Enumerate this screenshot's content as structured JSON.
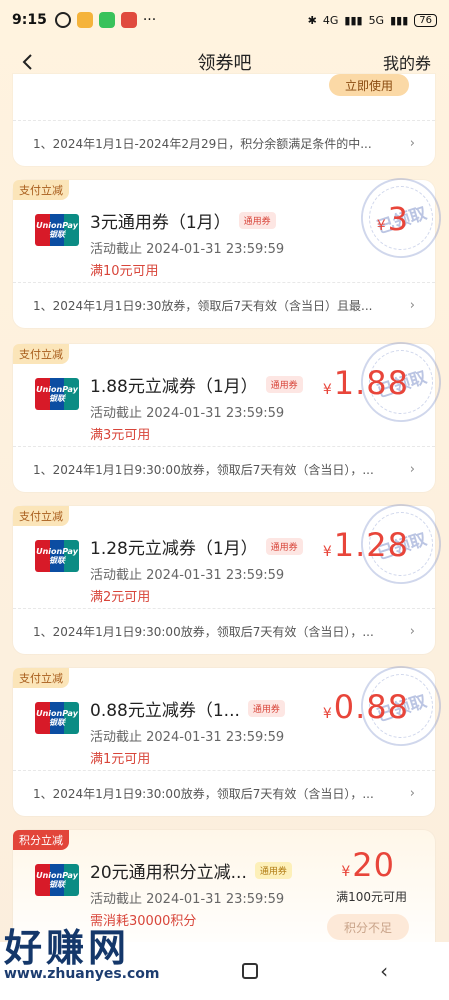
{
  "status_bar": {
    "time": "9:15",
    "network_1": "4G",
    "network_2": "5G",
    "battery": "76"
  },
  "header": {
    "title": "领券吧",
    "right_link": "我的券"
  },
  "partial_card": {
    "use_button": "立即使用",
    "note": "1、2024年1月1日-2024年2月29日，积分余额满足条件的中..."
  },
  "coupons": [
    {
      "tag": "支付立减",
      "title": "3元通用券（1月）",
      "badge": "通用券",
      "deadline": "活动截止 2024-01-31 23:59:59",
      "condition": "满10元可用",
      "currency": "¥",
      "amount": "3",
      "stamp": "已领取",
      "note": "1、2024年1月1日9:30放券，领取后7天有效（含当日）且最..."
    },
    {
      "tag": "支付立减",
      "title": "1.88元立减券（1月）",
      "badge": "通用券",
      "deadline": "活动截止 2024-01-31 23:59:59",
      "condition": "满3元可用",
      "currency": "¥",
      "amount": "1.88",
      "stamp": "已领取",
      "note": "1、2024年1月1日9:30:00放券，领取后7天有效（含当日），..."
    },
    {
      "tag": "支付立减",
      "title": "1.28元立减券（1月）",
      "badge": "通用券",
      "deadline": "活动截止 2024-01-31 23:59:59",
      "condition": "满2元可用",
      "currency": "¥",
      "amount": "1.28",
      "stamp": "已领取",
      "note": "1、2024年1月1日9:30:00放券，领取后7天有效（含当日），..."
    },
    {
      "tag": "支付立减",
      "title": "0.88元立减券（1...",
      "badge": "通用券",
      "deadline": "活动截止 2024-01-31 23:59:59",
      "condition": "满1元可用",
      "currency": "¥",
      "amount": "0.88",
      "stamp": "已领取",
      "note": "1、2024年1月1日9:30:00放券，领取后7天有效（含当日），..."
    }
  ],
  "points_card": {
    "tag": "积分立减",
    "title": "20元通用积分立减...",
    "badge": "通用券",
    "deadline": "活动截止 2024-01-31 23:59:59",
    "condition": "需消耗30000积分",
    "currency": "¥",
    "amount": "20",
    "min_text": "满100元可用",
    "button": "积分不足"
  },
  "unionpay": {
    "line1": "UnionPay",
    "line2": "银联"
  },
  "watermark": {
    "big": "好赚网",
    "small": "www.zhuanyes.com"
  },
  "colors": {
    "accent_red": "#e8453a",
    "tag_bg": "#fbe5b9",
    "page_bg": "#fbeedd"
  }
}
